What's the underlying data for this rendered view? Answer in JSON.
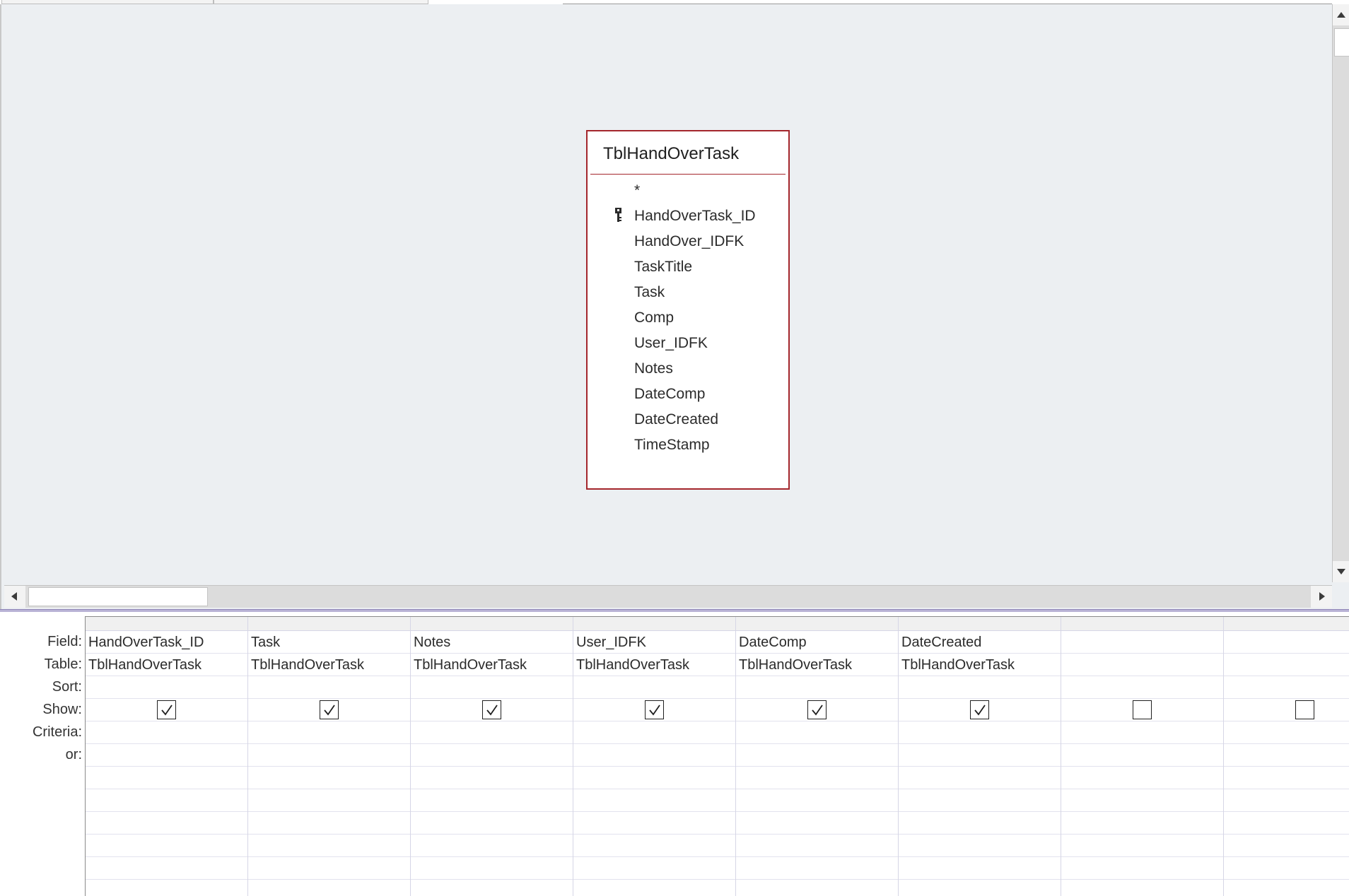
{
  "table": {
    "title": "TblHandOverTask",
    "fields": [
      {
        "label": "*",
        "primary_key": false
      },
      {
        "label": "HandOverTask_ID",
        "primary_key": true
      },
      {
        "label": "HandOver_IDFK",
        "primary_key": false
      },
      {
        "label": "TaskTitle",
        "primary_key": false
      },
      {
        "label": "Task",
        "primary_key": false
      },
      {
        "label": "Comp",
        "primary_key": false
      },
      {
        "label": "User_IDFK",
        "primary_key": false
      },
      {
        "label": "Notes",
        "primary_key": false
      },
      {
        "label": "DateComp",
        "primary_key": false
      },
      {
        "label": "DateCreated",
        "primary_key": false
      },
      {
        "label": "TimeStamp",
        "primary_key": false
      }
    ]
  },
  "grid": {
    "row_labels": [
      "Field:",
      "Table:",
      "Sort:",
      "Show:",
      "Criteria:",
      "or:"
    ],
    "columns": [
      {
        "field": "HandOverTask_ID",
        "table": "TblHandOverTask",
        "sort": "",
        "show": true,
        "criteria": "",
        "or": ""
      },
      {
        "field": "Task",
        "table": "TblHandOverTask",
        "sort": "",
        "show": true,
        "criteria": "",
        "or": ""
      },
      {
        "field": "Notes",
        "table": "TblHandOverTask",
        "sort": "",
        "show": true,
        "criteria": "",
        "or": ""
      },
      {
        "field": "User_IDFK",
        "table": "TblHandOverTask",
        "sort": "",
        "show": true,
        "criteria": "",
        "or": ""
      },
      {
        "field": "DateComp",
        "table": "TblHandOverTask",
        "sort": "",
        "show": true,
        "criteria": "",
        "or": ""
      },
      {
        "field": "DateCreated",
        "table": "TblHandOverTask",
        "sort": "",
        "show": true,
        "criteria": "",
        "or": ""
      },
      {
        "field": "",
        "table": "",
        "sort": "",
        "show": false,
        "criteria": "",
        "or": ""
      },
      {
        "field": "",
        "table": "",
        "sort": "",
        "show": false,
        "criteria": "",
        "or": ""
      }
    ],
    "extra_blank_rows": 6
  },
  "colors": {
    "table_border": "#a4262c",
    "design_background": "#eceff2"
  }
}
